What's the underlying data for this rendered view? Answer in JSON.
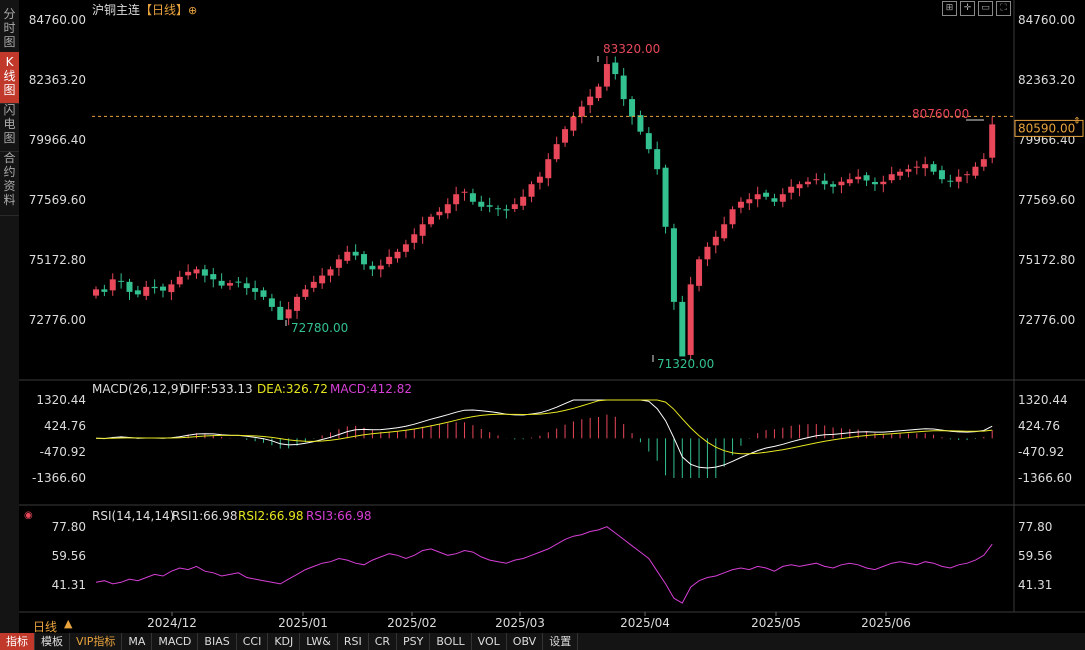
{
  "left_tabs": [
    {
      "label": "分\n时\n图",
      "active": false
    },
    {
      "label": "K\n线\n图",
      "active": true
    },
    {
      "label": "闪\n电\n图",
      "active": false
    },
    {
      "label": "合\n约\n资\n料",
      "active": false
    }
  ],
  "header": {
    "instrument": "沪铜主连",
    "period_tag": "【日线】",
    "period_icon": "target-icon"
  },
  "top_tools": [
    "grid-icon",
    "crosshair-icon",
    "layout-icon",
    "fullscreen-icon"
  ],
  "price_ticks": [
    "84760.00",
    "82363.20",
    "79966.40",
    "77569.60",
    "75172.80",
    "72776.00"
  ],
  "current_price": "80590.00",
  "annotations": {
    "high": "83320.00",
    "low": "71320.00",
    "local_low": "72780.00",
    "recent_high": "80760.00"
  },
  "macd": {
    "label": "MACD(26,12,9)",
    "diff_label": "DIFF:533.13",
    "dea_label": "DEA:326.72",
    "macd_label": "MACD:412.82",
    "ticks": [
      "1320.44",
      "424.76",
      "-470.92",
      "-1366.60"
    ]
  },
  "rsi": {
    "label": "RSI(14,14,14)",
    "rsi1_label": "RSI1:66.98",
    "rsi2_label": "RSI2:66.98",
    "rsi3_label": "RSI3:66.98",
    "ticks": [
      "77.80",
      "59.56",
      "41.31"
    ]
  },
  "x_labels": [
    "2024/12",
    "2025/01",
    "2025/02",
    "2025/03",
    "2025/04",
    "2025/05",
    "2025/06"
  ],
  "period_label": "日线",
  "bottom_tabs": [
    {
      "label": "指标",
      "active": true
    },
    {
      "label": "模板",
      "active": false
    },
    {
      "label": "VIP指标",
      "vip": true
    },
    {
      "label": "MA"
    },
    {
      "label": "MACD"
    },
    {
      "label": "BIAS"
    },
    {
      "label": "CCI"
    },
    {
      "label": "KDJ"
    },
    {
      "label": "LW&"
    },
    {
      "label": "RSI"
    },
    {
      "label": "CR"
    },
    {
      "label": "PSY"
    },
    {
      "label": "BOLL"
    },
    {
      "label": "VOL"
    },
    {
      "label": "OBV"
    },
    {
      "label": "设置"
    }
  ],
  "colors": {
    "up": "#e8485a",
    "down": "#33c190",
    "diff_line": "#ffffff",
    "dea_line": "#e6e620",
    "rsi_line": "#d63fd6",
    "accent": "#e8a33d",
    "price_label": "#e8485a"
  },
  "chart_data": {
    "type": "candlestick",
    "title": "沪铜主连【日线】",
    "ylim": [
      71320,
      84760
    ],
    "x": [
      "2024/12",
      "2025/01",
      "2025/02",
      "2025/03",
      "2025/04",
      "2025/05",
      "2025/06"
    ],
    "closes": [
      74000,
      73900,
      74400,
      74300,
      73900,
      73800,
      74100,
      74050,
      73950,
      74200,
      74500,
      74700,
      74800,
      74550,
      74400,
      74150,
      74250,
      74300,
      74050,
      73900,
      73700,
      73300,
      72780,
      73200,
      73700,
      74000,
      74300,
      74550,
      74800,
      75200,
      75500,
      75350,
      75000,
      74800,
      74950,
      75300,
      75500,
      75800,
      76200,
      76600,
      76900,
      77100,
      77400,
      77800,
      77900,
      77500,
      77300,
      77300,
      77200,
      77150,
      77400,
      77700,
      78200,
      78500,
      79200,
      79800,
      80400,
      80900,
      81300,
      81700,
      82100,
      83000,
      82600,
      81600,
      80900,
      80300,
      79600,
      78800,
      76500,
      73500,
      71320,
      74200,
      75200,
      75700,
      76100,
      76600,
      77200,
      77500,
      77600,
      77800,
      77700,
      77500,
      77800,
      78100,
      78200,
      78300,
      78400,
      78200,
      78100,
      78300,
      78400,
      78500,
      78350,
      78200,
      78300,
      78600,
      78700,
      78800,
      78900,
      79000,
      78700,
      78400,
      78300,
      78500,
      78600,
      78900,
      79200,
      80590
    ],
    "current_price": 80590,
    "high": 83320,
    "low": 71320,
    "macd": {
      "diff": 533.13,
      "dea": 326.72,
      "macd": 412.82,
      "ylim": [
        -1366.6,
        1320.44
      ]
    },
    "rsi": {
      "rsi1": 66.98,
      "rsi2": 66.98,
      "rsi3": 66.98,
      "ylim": [
        41.31,
        77.8
      ],
      "values": [
        43,
        44,
        42,
        43,
        45,
        44,
        46,
        48,
        47,
        50,
        52,
        51,
        53,
        50,
        49,
        47,
        48,
        49,
        46,
        45,
        44,
        43,
        42,
        45,
        48,
        51,
        53,
        55,
        56,
        58,
        57,
        55,
        54,
        57,
        59,
        61,
        60,
        58,
        60,
        63,
        64,
        62,
        60,
        61,
        63,
        62,
        59,
        57,
        56,
        55,
        57,
        58,
        60,
        62,
        64,
        67,
        70,
        72,
        73,
        75,
        76,
        78,
        74,
        70,
        66,
        62,
        58,
        50,
        42,
        33,
        30,
        40,
        44,
        46,
        47,
        49,
        51,
        52,
        51,
        53,
        52,
        50,
        53,
        54,
        53,
        54,
        55,
        53,
        52,
        54,
        55,
        54,
        52,
        51,
        53,
        55,
        56,
        55,
        54,
        56,
        55,
        53,
        52,
        54,
        55,
        57,
        60,
        67
      ]
    }
  }
}
